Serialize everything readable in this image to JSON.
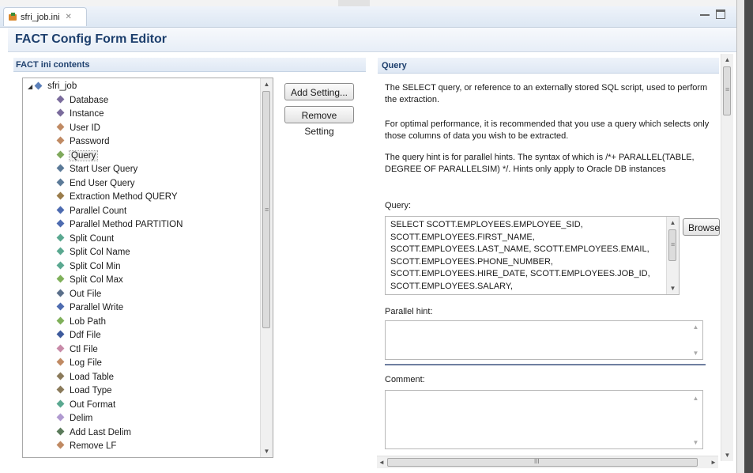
{
  "tab": {
    "title": "sfri_job.ini",
    "close": "✕"
  },
  "form": {
    "title": "FACT Config Form Editor"
  },
  "left": {
    "section_title": "FACT ini contents",
    "root": "sfri_job",
    "items": [
      {
        "label": "Database",
        "color": "#7a6b9c"
      },
      {
        "label": "Instance",
        "color": "#7a6b9c"
      },
      {
        "label": "User ID",
        "color": "#c08a63"
      },
      {
        "label": "Password",
        "color": "#c08a63"
      },
      {
        "label": "Query",
        "color": "#7fa95c"
      },
      {
        "label": "Start User Query",
        "color": "#5b7a98"
      },
      {
        "label": "End User Query",
        "color": "#5b7a98"
      },
      {
        "label": "Extraction Method QUERY",
        "color": "#9a7c4a"
      },
      {
        "label": "Parallel Count",
        "color": "#4d6bb0"
      },
      {
        "label": "Parallel Method PARTITION",
        "color": "#4d6bb0"
      },
      {
        "label": "Split Count",
        "color": "#5aa890"
      },
      {
        "label": "Split Col Name",
        "color": "#5aa890"
      },
      {
        "label": "Split Col Min",
        "color": "#5aa890"
      },
      {
        "label": "Split Col Max",
        "color": "#7fb05a"
      },
      {
        "label": "Out File",
        "color": "#5a6f8a"
      },
      {
        "label": "Parallel Write",
        "color": "#4d6bb0"
      },
      {
        "label": "Lob Path",
        "color": "#7fb05a"
      },
      {
        "label": "Ddf File",
        "color": "#3d5a9c"
      },
      {
        "label": "Ctl File",
        "color": "#c88aa8"
      },
      {
        "label": "Log File",
        "color": "#c08a63"
      },
      {
        "label": "Load Table",
        "color": "#8a7a5a"
      },
      {
        "label": "Load Type",
        "color": "#8a7a5a"
      },
      {
        "label": "Out Format",
        "color": "#5aa890"
      },
      {
        "label": "Delim",
        "color": "#b09ad0"
      },
      {
        "label": "Add Last Delim",
        "color": "#5a7a5a"
      },
      {
        "label": "Remove LF",
        "color": "#c08a63"
      }
    ],
    "add_setting": "Add Setting...",
    "remove_setting": "Remove Setting"
  },
  "right": {
    "section_title": "Query",
    "desc1": "The SELECT query, or reference to an externally stored SQL script, used to perform the extraction.",
    "desc2": "For optimal performance, it is recommended that you use a query which selects only those columns of data you wish to be extracted.",
    "desc3": "The query hint is for parallel hints. The syntax of which is /*+ PARALLEL(TABLE, DEGREE OF PARALLELSIM) */.  Hints only apply to Oracle DB instances",
    "query_label": "Query:",
    "query_value": "SELECT SCOTT.EMPLOYEES.EMPLOYEE_SID,\nSCOTT.EMPLOYEES.FIRST_NAME,\nSCOTT.EMPLOYEES.LAST_NAME, SCOTT.EMPLOYEES.EMAIL,\nSCOTT.EMPLOYEES.PHONE_NUMBER,\nSCOTT.EMPLOYEES.HIRE_DATE, SCOTT.EMPLOYEES.JOB_ID,\nSCOTT.EMPLOYEES.SALARY,",
    "browse": "Browse",
    "parallel_hint_label": "Parallel hint:",
    "comment_label": "Comment:",
    "hscroll_grip": "III"
  }
}
